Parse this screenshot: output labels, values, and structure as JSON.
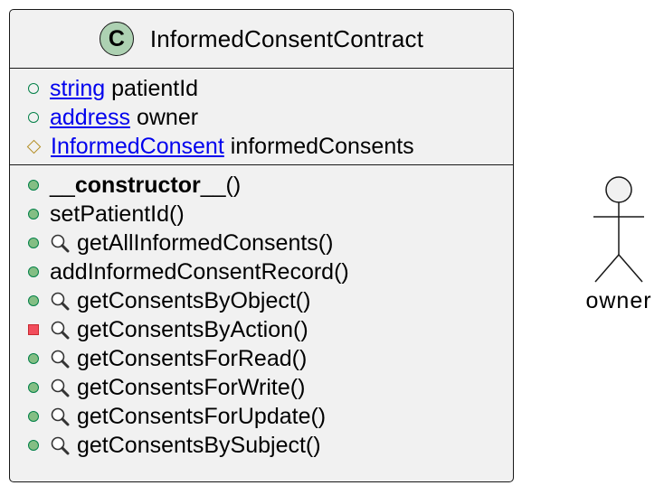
{
  "class": {
    "stereotype_letter": "C",
    "name": "InformedConsentContract",
    "fields": [
      {
        "visibility": "public",
        "type": "string",
        "name": "patientId"
      },
      {
        "visibility": "public",
        "type": "address",
        "name": "owner"
      },
      {
        "visibility": "protected",
        "type": "InformedConsent",
        "name": "informedConsents"
      }
    ],
    "methods": {
      "constructor": {
        "prefix": "__",
        "name": "constructor",
        "suffix": "__()"
      },
      "m1": "setPatientId()",
      "m2": "getAllInformedConsents()",
      "m3": "addInformedConsentRecord()",
      "m4": "getConsentsByObject()",
      "m5": "getConsentsByAction()",
      "m6": "getConsentsForRead()",
      "m7": "getConsentsForWrite()",
      "m8": "getConsentsForUpdate()",
      "m9": "getConsentsBySubject()"
    }
  },
  "actor": {
    "label": "owner"
  },
  "colors": {
    "class_bg": "#f1f1f1",
    "stereotype_circle": "#add1b2",
    "public_green": "#84be84",
    "private_red": "#f24d5c",
    "protected_gold": "#b38d22",
    "link_blue": "#0000ee"
  }
}
